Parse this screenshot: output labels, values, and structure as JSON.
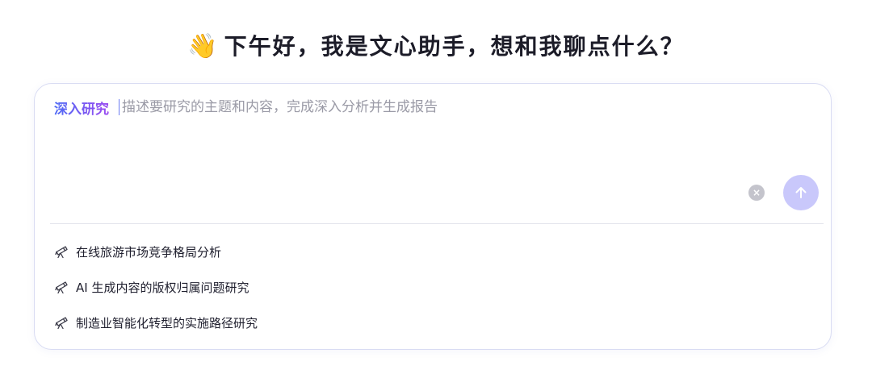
{
  "greeting": {
    "icon": "waving-hand-icon",
    "emoji": "👋",
    "text": "下午好，我是文心助手，想和我聊点什么？"
  },
  "composer": {
    "mode_label": "深入研究",
    "placeholder": "描述要研究的主题和内容，完成深入分析并生成报告",
    "value": "",
    "clear_icon": "close-circle-icon",
    "clear_glyph": "×",
    "send_icon": "arrow-up-icon",
    "send_button_color": "#c9c8fb"
  },
  "suggestions": [
    {
      "icon": "telescope-icon",
      "label": "在线旅游市场竞争格局分析"
    },
    {
      "icon": "telescope-icon",
      "label": "AI 生成内容的版权归属问题研究"
    },
    {
      "icon": "telescope-icon",
      "label": "制造业智能化转型的实施路径研究"
    }
  ]
}
